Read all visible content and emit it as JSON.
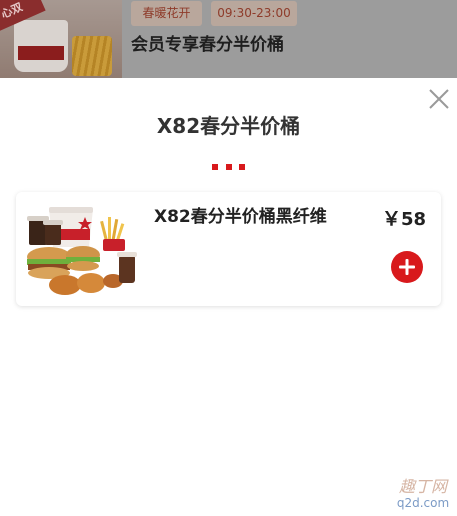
{
  "background": {
    "corner_badge": "心双",
    "tags": [
      "春暖花开",
      "09:30-23:00"
    ],
    "title": "会员专享春分半价桶"
  },
  "modal": {
    "title": "X82春分半价桶",
    "close_icon": "close-icon",
    "items": [
      {
        "name": "X82春分半价桶黑纤维",
        "currency": "￥",
        "price": "58",
        "add_icon": "plus-circle-icon"
      }
    ]
  },
  "watermark": {
    "logo": "趣丁网",
    "url": "q2d.com"
  },
  "colors": {
    "accent_red": "#d8191c",
    "overlay_gray": "#9c9c9c",
    "title_text": "#333333"
  }
}
